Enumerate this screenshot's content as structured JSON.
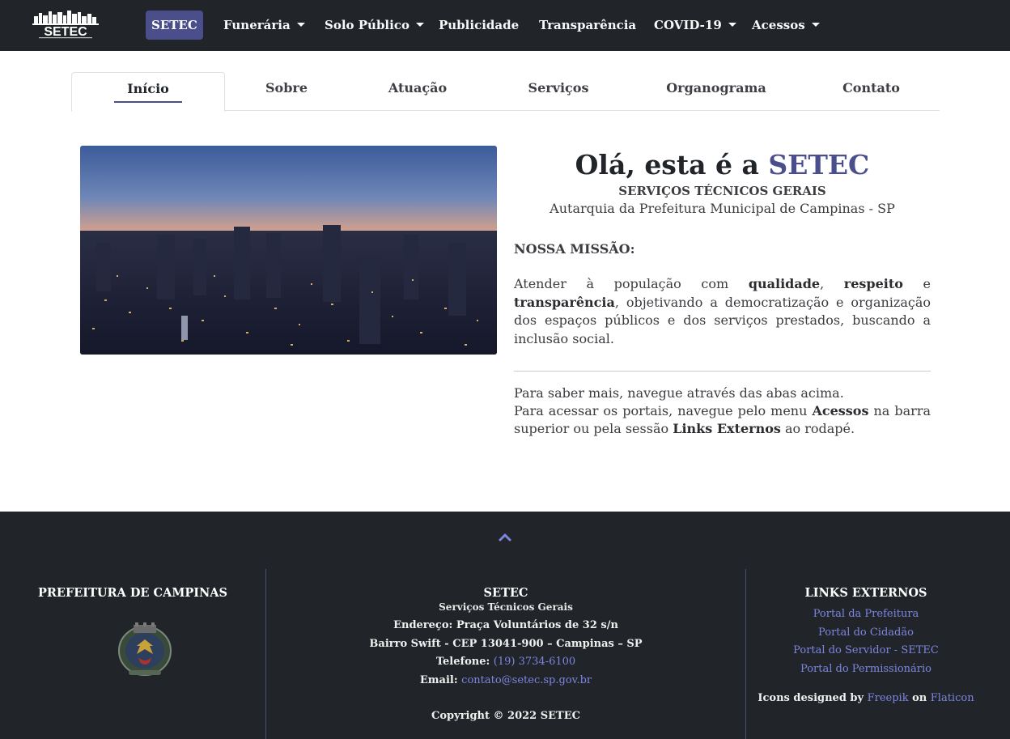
{
  "nav": {
    "items": [
      {
        "label": "SETEC",
        "dropdown": false,
        "active": true
      },
      {
        "label": "Funerária",
        "dropdown": true
      },
      {
        "label": "Solo Público",
        "dropdown": true
      },
      {
        "label": "Publicidade",
        "dropdown": false
      },
      {
        "label": "Transparência",
        "dropdown": false
      },
      {
        "label": "COVID-19",
        "dropdown": true
      },
      {
        "label": "Acessos",
        "dropdown": true
      }
    ]
  },
  "tabs": [
    "Início",
    "Sobre",
    "Atuação",
    "Serviços",
    "Organograma",
    "Contato"
  ],
  "hero": {
    "greeting_prefix": "Olá, esta é a ",
    "brand": "SETEC",
    "subtitle": "SERVIÇOS TÉCNICOS GERAIS",
    "tagline": "Autarquia da Prefeitura Municipal de Campinas - SP",
    "mission_title": "NOSSA MISSÃO:",
    "mission_parts": [
      "Atender à população com ",
      "qualidade",
      ", ",
      "respeito",
      " e ",
      "transparência",
      ", objetivando a democratização e organização dos espaços públicos e dos serviços prestados, buscando a inclusão social."
    ],
    "more_line1": "Para saber mais, navegue através das abas acima.",
    "more_parts": [
      "Para acessar os portais, navegue pelo menu ",
      "Acessos",
      " na barra superior ou pela sessão ",
      "Links Externos",
      " ao rodapé."
    ]
  },
  "footer": {
    "left_title": "PREFEITURA DE CAMPINAS",
    "center_title": "SETEC",
    "center_subtitle": "Serviços Técnicos Gerais",
    "address": "Endereço: Praça Voluntários de 32 s/n",
    "district": "Bairro Swift - CEP 13041-900 – Campinas – SP",
    "phone_label": "Telefone: ",
    "phone": "(19) 3734-6100",
    "email_label": "Email: ",
    "email": "contato@setec.sp.gov.br",
    "copyright": "Copyright © 2022 SETEC",
    "right_title": "LINKS EXTERNOS",
    "links": [
      "Portal da Prefeitura",
      "Portal do Cidadão",
      "Portal do Servidor - SETEC",
      "Portal do Permissionário"
    ],
    "credit_prefix": "Icons designed by ",
    "credit_freepik": "Freepik",
    "credit_on": " on ",
    "credit_flaticon": "Flaticon"
  },
  "colors": {
    "navbar_bg": "#212529",
    "accent": "#4a4f8c",
    "link": "#7d85e0",
    "footer_bg": "#212529"
  },
  "icons": {
    "logo": "setec-skyline-logo",
    "caret": "caret-down-icon",
    "back_to_top": "chevron-up-icon",
    "seal": "campinas-coat-of-arms"
  }
}
